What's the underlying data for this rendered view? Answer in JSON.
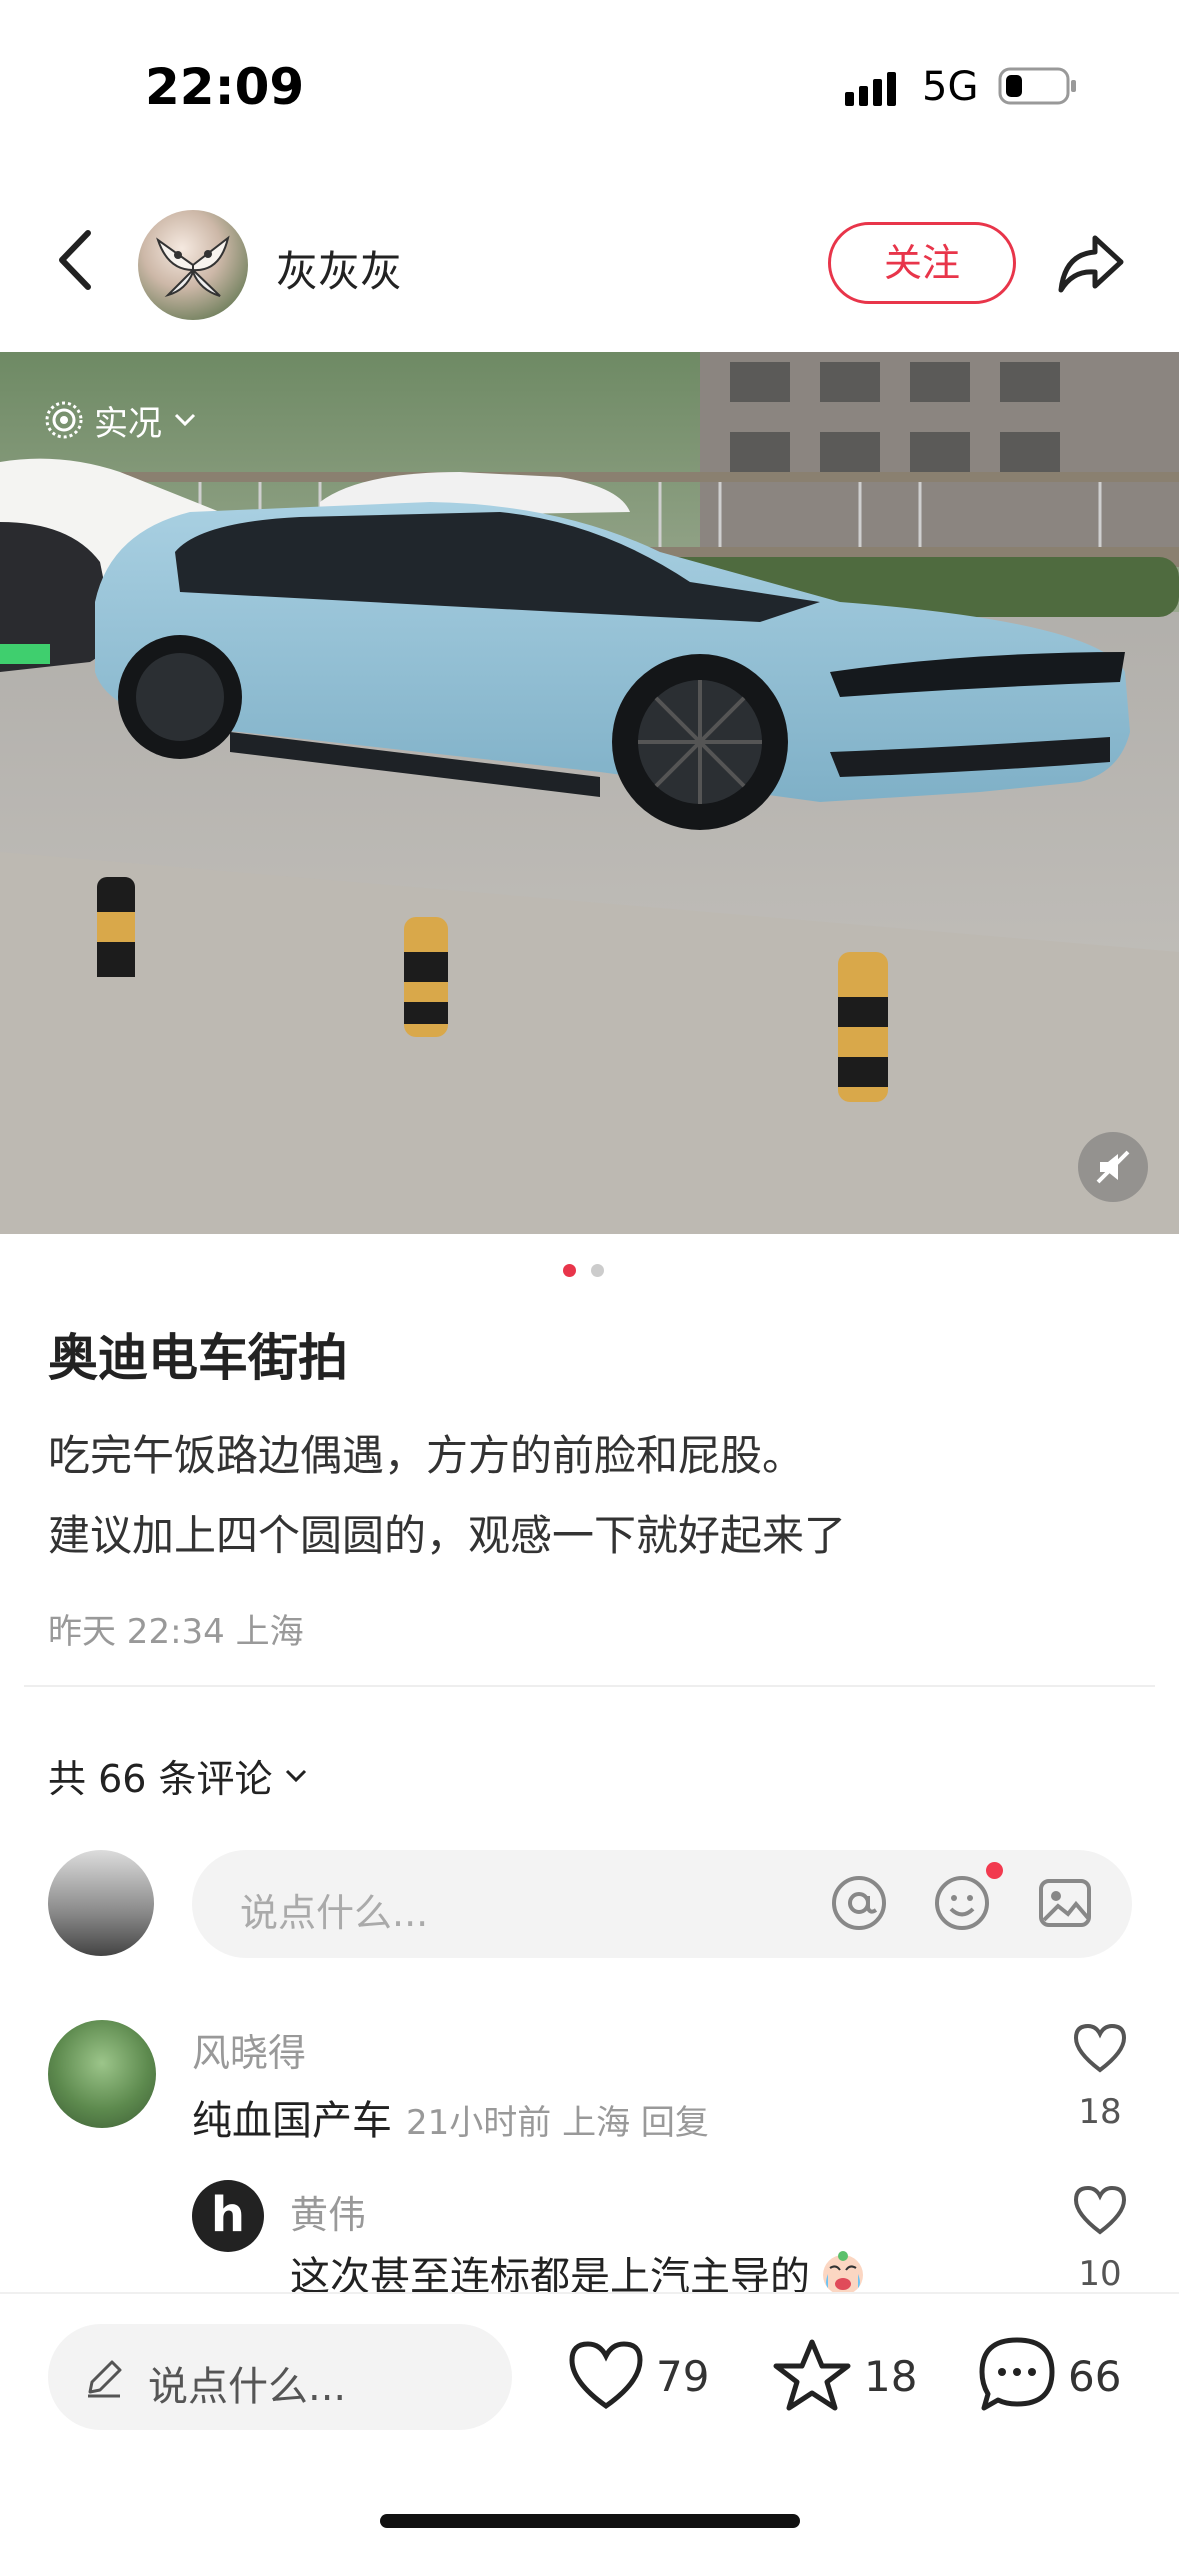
{
  "status_bar": {
    "time": "22:09",
    "network": "5G"
  },
  "header": {
    "username": "灰灰灰",
    "follow_label": "关注"
  },
  "media": {
    "live_label": "实况",
    "page_count": 2,
    "current_page": 1
  },
  "post": {
    "title": "奥迪电车街拍",
    "body_lines": [
      "吃完午饭路边偶遇，方方的前脸和屁股。",
      "建议加上四个圆圆的，观感一下就好起来了"
    ],
    "meta": "昨天 22:34 上海"
  },
  "comments": {
    "count_label": "共 66 条评论",
    "input_placeholder": "说点什么...",
    "items": [
      {
        "name": "风晓得",
        "text": "纯血国产车",
        "meta": "21小时前 上海 回复",
        "likes": "18"
      },
      {
        "name": "黄伟",
        "text": "这次甚至连标都是上汽主导的",
        "avatar_letter": "h",
        "likes": "10"
      }
    ]
  },
  "bottom_bar": {
    "input_placeholder": "说点什么...",
    "likes": "79",
    "stars": "18",
    "comments": "66"
  },
  "colors": {
    "accent": "#e8354a",
    "car_body": "#8fbfd6"
  }
}
